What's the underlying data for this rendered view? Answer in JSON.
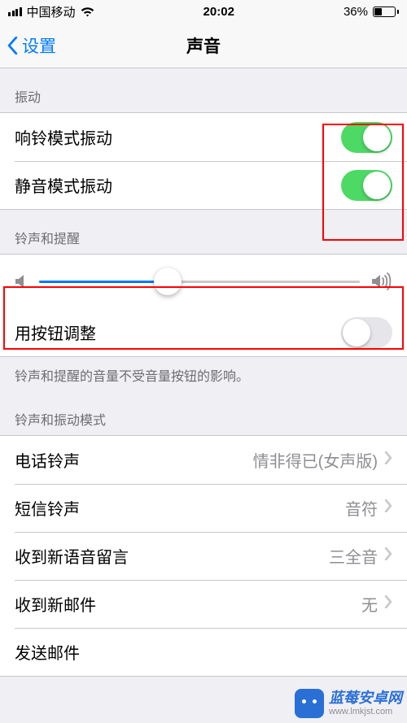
{
  "status_bar": {
    "carrier": "中国移动",
    "time": "20:02",
    "battery_text": "36%"
  },
  "nav": {
    "back_label": "设置",
    "title": "声音"
  },
  "sections": {
    "vibration": {
      "header": "振动",
      "ring_vibrate_label": "响铃模式振动",
      "silent_vibrate_label": "静音模式振动"
    },
    "ringer": {
      "header": "铃声和提醒",
      "change_with_buttons_label": "用按钮调整",
      "footer": "铃声和提醒的音量不受音量按钮的影响。",
      "slider_percent": 40
    },
    "patterns": {
      "header": "铃声和振动模式",
      "ringtone": {
        "label": "电话铃声",
        "value": "情非得已(女声版)"
      },
      "text_tone": {
        "label": "短信铃声",
        "value": "音符"
      },
      "voicemail": {
        "label": "收到新语音留言",
        "value": "三全音"
      },
      "mail": {
        "label": "收到新邮件",
        "value": "无"
      },
      "sent": {
        "label": "发送邮件"
      }
    }
  },
  "watermark": {
    "line1": "蓝莓安卓网",
    "line2": "www.lmkjst.com"
  },
  "icons": {
    "wifi": "wifi-icon",
    "vol_low": "volume-low-icon",
    "vol_high": "volume-high-icon",
    "chevron": "chevron-right-icon",
    "back": "chevron-left-icon"
  },
  "colors": {
    "accent": "#007aff",
    "switch_on": "#4cd964",
    "highlight": "#ff0000"
  }
}
